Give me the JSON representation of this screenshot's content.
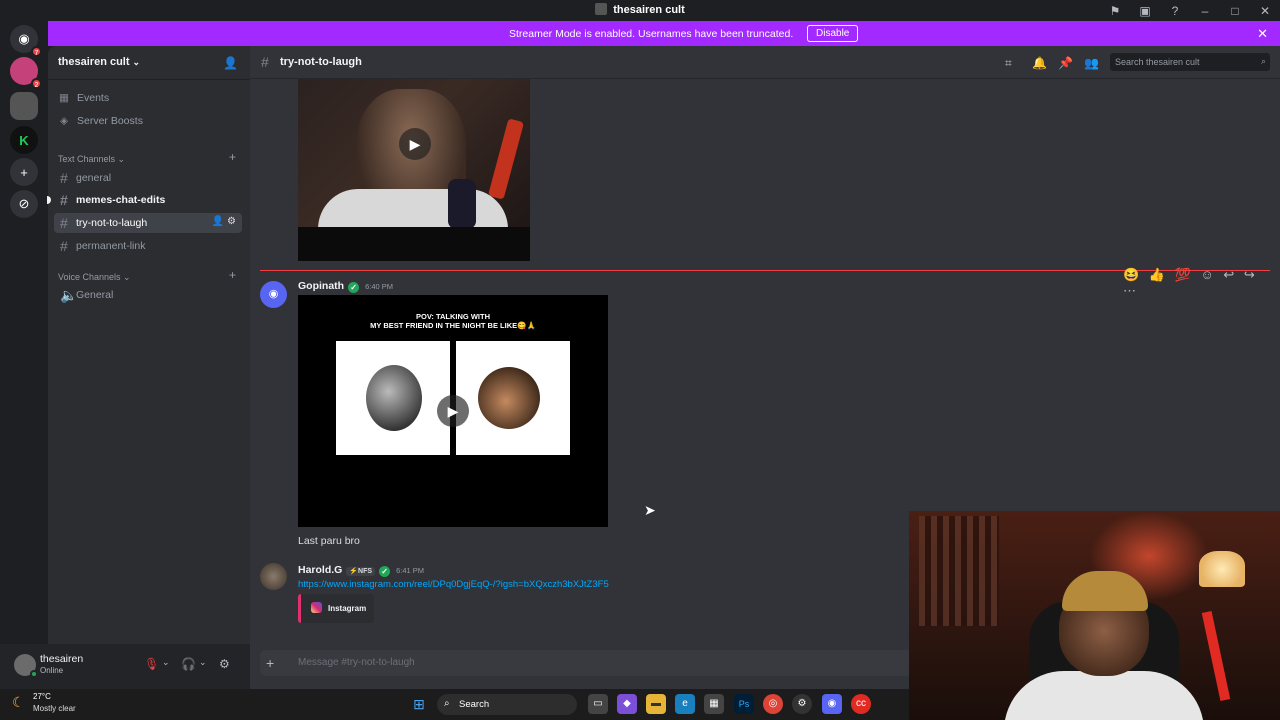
{
  "window": {
    "title": "thesairen cult"
  },
  "banner": {
    "text": "Streamer Mode is enabled. Usernames have been truncated.",
    "button": "Disable"
  },
  "rail": {
    "badge1": "7",
    "badge2": "2"
  },
  "server": {
    "name": "thesairen cult"
  },
  "sidebar": {
    "top_items": [
      {
        "label": "Events"
      },
      {
        "label": "Server Boosts"
      }
    ],
    "text_category": "Text Channels",
    "text_channels": [
      {
        "label": "general"
      },
      {
        "label": "memes-chat-edits"
      },
      {
        "label": "try-not-to-laugh"
      },
      {
        "label": "permanent-link"
      }
    ],
    "voice_category": "Voice Channels",
    "voice_channels": [
      {
        "label": "General"
      }
    ]
  },
  "user": {
    "name": "thesairen",
    "status": "Online"
  },
  "chat": {
    "channel": "try-not-to-laugh",
    "search_placeholder": "Search thesairen cult",
    "composer_placeholder": "Message #try-not-to-laugh",
    "messages": [
      {
        "author": "Gopinath",
        "time": "6:40 PM",
        "video_caption_line1": "POV: TALKING WITH",
        "video_caption_line2": "MY BEST FRIEND IN THE NIGHT BE LIKE😋🙏",
        "text": "Last paru bro"
      },
      {
        "author": "Harold.G",
        "tag": "⚡NFS",
        "time": "6:41 PM",
        "link": "https://www.instagram.com/reel/DPq0DgjEqQ-/?igsh=bXQxczh3bXJtZ3F5",
        "embed": "Instagram"
      }
    ]
  },
  "taskbar": {
    "temp": "27°C",
    "weather": "Mostly clear",
    "search": "Search"
  },
  "colors": {
    "banner": "#a229ff",
    "accent": "#5865f2",
    "link": "#00a8fc",
    "online": "#23a55a"
  }
}
